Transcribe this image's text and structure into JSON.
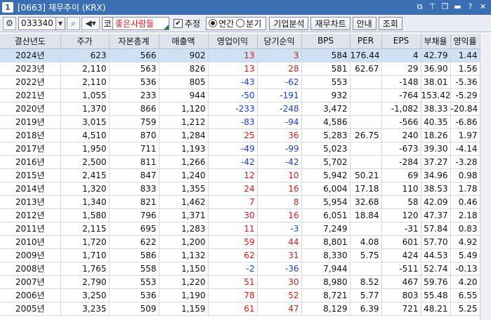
{
  "window": {
    "number": "1",
    "title": "[0663] 재무추이 (KRX)"
  },
  "toolbar": {
    "stock_code": "033340",
    "market_badge": "코",
    "stock_name": "좋은사람들",
    "estimate_label": "추정",
    "estimate_checked": true,
    "annual_label": "연간",
    "quarter_label": "분기",
    "buttons": [
      "기업분석",
      "재무차트",
      "안내",
      "조회"
    ]
  },
  "table": {
    "headers": [
      "결산년도",
      "주가",
      "자본총계",
      "매출액",
      "영업이익",
      "당기순익",
      "BPS",
      "PER",
      "EPS",
      "부채율",
      "영익률"
    ],
    "rows": [
      [
        "2024년",
        "623",
        "566",
        "902",
        "13",
        "3",
        "584",
        "176.44",
        "4",
        "42.79",
        "1.44"
      ],
      [
        "2023년",
        "2,110",
        "563",
        "826",
        "13",
        "28",
        "581",
        "62.67",
        "29",
        "36.90",
        "1.56"
      ],
      [
        "2022년",
        "2,110",
        "536",
        "805",
        "-43",
        "-62",
        "553",
        "",
        "-148",
        "38.01",
        "-5.36"
      ],
      [
        "2021년",
        "1,055",
        "233",
        "944",
        "-50",
        "-191",
        "932",
        "",
        "-764",
        "153.42",
        "-5.29"
      ],
      [
        "2020년",
        "1,370",
        "866",
        "1,120",
        "-233",
        "-248",
        "3,472",
        "",
        "-1,082",
        "38.33",
        "-20.84"
      ],
      [
        "2019년",
        "3,015",
        "759",
        "1,212",
        "-83",
        "-94",
        "4,586",
        "",
        "-566",
        "40.35",
        "-6.86"
      ],
      [
        "2018년",
        "4,510",
        "870",
        "1,284",
        "25",
        "36",
        "5,283",
        "26.75",
        "240",
        "18.26",
        "1.97"
      ],
      [
        "2017년",
        "1,950",
        "711",
        "1,193",
        "-49",
        "-99",
        "5,023",
        "",
        "-673",
        "39.30",
        "-4.14"
      ],
      [
        "2016년",
        "2,500",
        "811",
        "1,266",
        "-42",
        "-42",
        "5,702",
        "",
        "-284",
        "37.27",
        "-3.28"
      ],
      [
        "2015년",
        "2,415",
        "847",
        "1,240",
        "12",
        "10",
        "5,942",
        "50.21",
        "69",
        "34.96",
        "0.98"
      ],
      [
        "2014년",
        "1,320",
        "833",
        "1,355",
        "24",
        "16",
        "6,004",
        "17.18",
        "110",
        "38.53",
        "1.78"
      ],
      [
        "2013년",
        "1,340",
        "821",
        "1,462",
        "7",
        "8",
        "5,954",
        "32.68",
        "58",
        "42.09",
        "0.46"
      ],
      [
        "2012년",
        "1,580",
        "796",
        "1,371",
        "30",
        "16",
        "6,051",
        "18.84",
        "120",
        "47.37",
        "2.18"
      ],
      [
        "2011년",
        "2,115",
        "695",
        "1,283",
        "11",
        "-3",
        "7,249",
        "",
        "-31",
        "57.84",
        "0.83"
      ],
      [
        "2010년",
        "1,720",
        "622",
        "1,200",
        "59",
        "44",
        "8,801",
        "4.08",
        "601",
        "57.70",
        "4.92"
      ],
      [
        "2009년",
        "1,710",
        "586",
        "1,132",
        "62",
        "31",
        "8,330",
        "5.75",
        "424",
        "44.53",
        "5.49"
      ],
      [
        "2008년",
        "1,765",
        "558",
        "1,150",
        "-2",
        "-36",
        "7,944",
        "",
        "-511",
        "52.74",
        "-0.13"
      ],
      [
        "2007년",
        "2,790",
        "553",
        "1,220",
        "51",
        "30",
        "8,980",
        "8.52",
        "467",
        "59.76",
        "4.20"
      ],
      [
        "2006년",
        "3,250",
        "536",
        "1,190",
        "78",
        "52",
        "8,721",
        "5.77",
        "803",
        "55.48",
        "6.55"
      ],
      [
        "2005년",
        "3,235",
        "509",
        "1,159",
        "61",
        "47",
        "8,129",
        "6.39",
        "721",
        "48.21",
        "5.25"
      ]
    ]
  },
  "colors": {
    "title_bar": "#3a6fb4",
    "positive": "#d01c1c",
    "negative": "#1a3fd0",
    "selected_row": "#cfe1f5"
  }
}
